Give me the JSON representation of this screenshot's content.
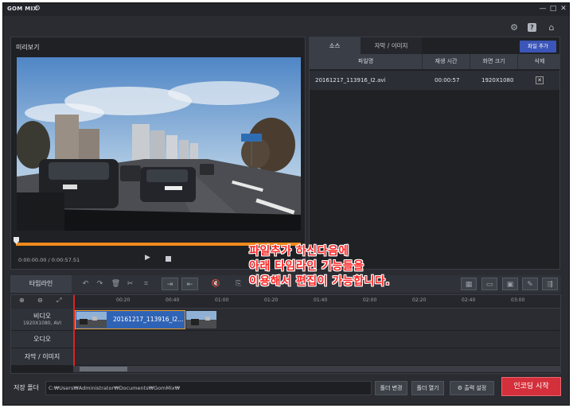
{
  "app": {
    "title": "GOM MIX"
  },
  "window_controls": {
    "minimize": "—",
    "maximize": "□",
    "close": "✕"
  },
  "top_icons": [
    "gear-icon",
    "help-icon",
    "home-icon"
  ],
  "preview": {
    "title": "미리보기",
    "timecode": "0:00:00.00 / 0:00:57.51",
    "seek_progress": 0
  },
  "source_panel": {
    "tabs": [
      "소스",
      "자막 / 이미지"
    ],
    "add_file_label": "파일 추가",
    "columns": [
      "파일명",
      "재생 시간",
      "화면 크기",
      "삭제"
    ],
    "rows": [
      {
        "filename": "20161217_113916_I2.avi",
        "duration": "00:00:57",
        "resolution": "1920X1080",
        "delete": "✕"
      }
    ]
  },
  "timeline_toolbar": {
    "label": "타임라인"
  },
  "timeline": {
    "ruler_ticks": [
      "00:20",
      "00:40",
      "01:00",
      "01:20",
      "01:40",
      "02:00",
      "02:20",
      "02:40",
      "03:00"
    ],
    "tracks": [
      {
        "label": "비디오",
        "sublabel": "1920X1080, AVI"
      },
      {
        "label": "오디오",
        "sublabel": ""
      },
      {
        "label": "자막 / 이미지",
        "sublabel": ""
      }
    ],
    "clip_name": "20161217_113916_I2..."
  },
  "bottom": {
    "save_folder_label": "저장 폴더",
    "path": "C:₩Users₩Administrator₩Documents₩GomMix₩",
    "change_folder": "폴더 변경",
    "open_folder": "폴더 열기",
    "output_settings": "출력 설정",
    "encode_start": "인코딩 시작"
  },
  "annotation": {
    "lines": [
      "파일추가 하신다음에",
      "아래 타임라인 기능들을",
      "이용해서 편집이 가능합니다."
    ]
  },
  "colors": {
    "accent_orange": "#f08a1d",
    "add_file_blue": "#3b56b8",
    "encode_red": "#d3303b",
    "annotation_red": "#ff2424"
  }
}
